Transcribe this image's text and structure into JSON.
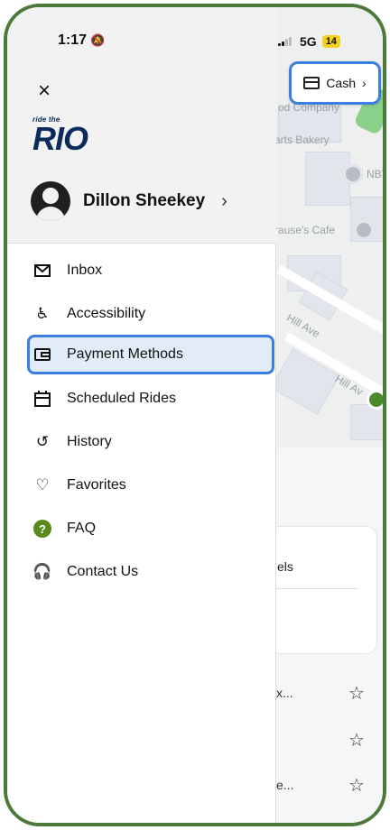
{
  "status_bar": {
    "time": "1:17",
    "network": "5G",
    "battery": "14"
  },
  "map": {
    "labels": [
      "od Company",
      "arts Bakery",
      "NBT",
      "rause's Cafe",
      "Hill Ave",
      "Hill Av"
    ],
    "payment_button": {
      "label": "Cash",
      "chevron": "›"
    }
  },
  "sheet": {
    "card_text": "els",
    "rows": [
      {
        "text": "x..."
      },
      {
        "text": ""
      },
      {
        "text": "e..."
      }
    ]
  },
  "drawer": {
    "close_icon": "×",
    "logo": {
      "tagline": "ride the",
      "name": "RIO"
    },
    "profile": {
      "name": "Dillon Sheekey",
      "chevron": "›"
    },
    "menu": [
      {
        "label": "Inbox",
        "icon": "mail-icon"
      },
      {
        "label": "Accessibility",
        "icon": "accessibility-icon"
      },
      {
        "label": "Payment Methods",
        "icon": "wallet-icon",
        "active": true
      },
      {
        "label": "Scheduled Rides",
        "icon": "calendar-icon"
      },
      {
        "label": "History",
        "icon": "history-icon"
      },
      {
        "label": "Favorites",
        "icon": "heart-icon"
      },
      {
        "label": "FAQ",
        "icon": "help-icon"
      },
      {
        "label": "Contact Us",
        "icon": "headset-icon"
      }
    ]
  },
  "colors": {
    "accent": "#3a7fe0",
    "frame": "#4b7a3a",
    "logo": "#0b2b5a",
    "faq": "#5a8a1c"
  }
}
